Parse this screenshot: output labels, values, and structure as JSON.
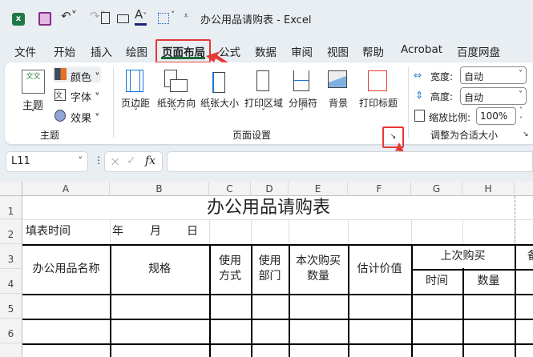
{
  "titlebar": {
    "doc_title": "办公用品请购表",
    "separator": "-",
    "app": "Excel"
  },
  "tabs": [
    "文件",
    "开始",
    "插入",
    "绘图",
    "页面布局",
    "公式",
    "数据",
    "审阅",
    "视图",
    "帮助",
    "Acrobat",
    "百度网盘"
  ],
  "active_tab": "页面布局",
  "ribbon": {
    "themes": {
      "theme": "主题",
      "colors": "颜色",
      "fonts": "字体",
      "effects": "效果",
      "group": "主题"
    },
    "page_setup": {
      "margins": "页边距",
      "orientation": "纸张方向",
      "size": "纸张大小",
      "print_area": "打印区域",
      "breaks": "分隔符",
      "background": "背景",
      "print_titles": "打印标题",
      "group": "页面设置"
    },
    "scale": {
      "width_label": "宽度:",
      "width_value": "自动",
      "height_label": "高度:",
      "height_value": "自动",
      "scale_label": "缩放比例:",
      "scale_value": "100%",
      "group": "调整为合适大小"
    }
  },
  "formula_bar": {
    "name_box": "L11",
    "fx": "fx",
    "value": ""
  },
  "sheet": {
    "columns": [
      "A",
      "B",
      "C",
      "D",
      "E",
      "F",
      "G",
      "H"
    ],
    "rows": [
      "1",
      "2",
      "3",
      "4",
      "5",
      "6"
    ],
    "title": "办公用品请购表",
    "row2": {
      "fill_time": "填表时间",
      "year": "年",
      "month": "月",
      "day": "日"
    },
    "headers": {
      "name": "办公用品名称",
      "spec": "规格",
      "usage": "使用\n方式",
      "dept": "使用\n部门",
      "qty": "本次购买\n数量",
      "est": "估计价值",
      "last": "上次购买",
      "last_time": "时间",
      "last_qty": "数量",
      "next": "备"
    }
  },
  "colors": {
    "accent_green": "#1e6b3a",
    "annotation_red": "#e53935"
  }
}
